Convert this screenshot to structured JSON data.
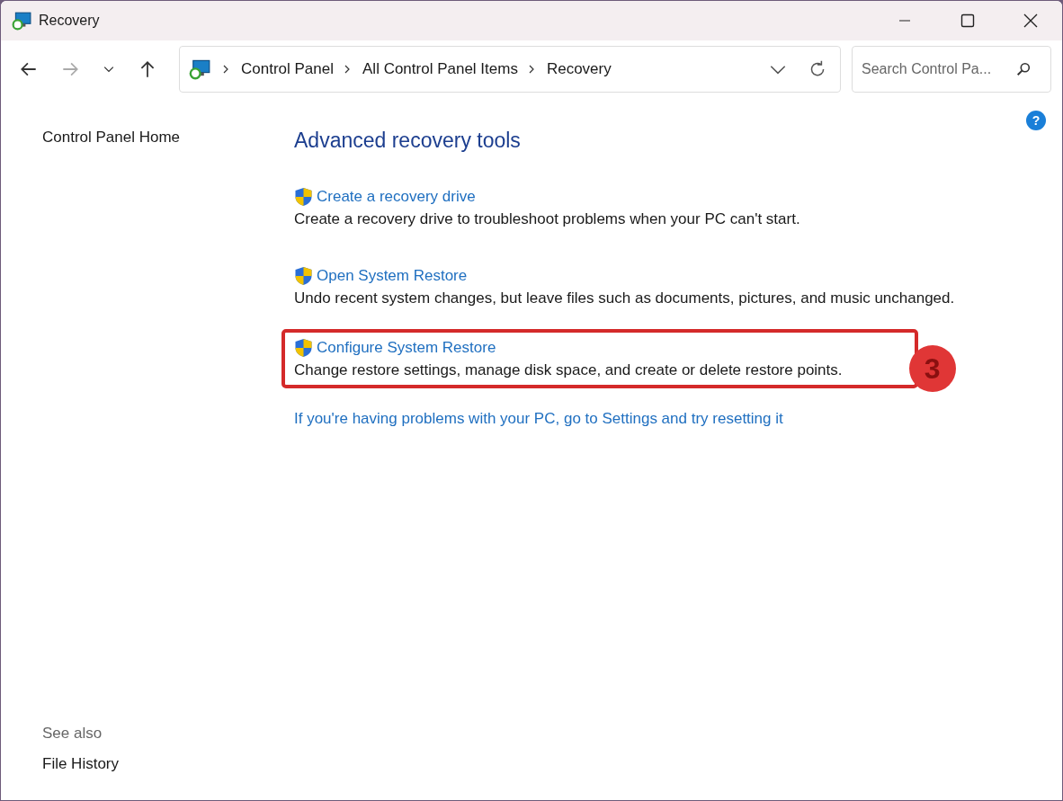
{
  "window": {
    "title": "Recovery"
  },
  "navigation": {
    "back_disabled": false,
    "forward_disabled": true,
    "breadcrumbs": [
      "Control Panel",
      "All Control Panel Items",
      "Recovery"
    ],
    "search": {
      "placeholder": "Search Control Pa..."
    }
  },
  "help_button": "?",
  "sidebar": {
    "home_link": "Control Panel Home",
    "see_also": {
      "heading": "See also",
      "links": [
        "File History"
      ]
    }
  },
  "main": {
    "heading": "Advanced recovery tools",
    "tasks": [
      {
        "link": "Create a recovery drive",
        "description": "Create a recovery drive to troubleshoot problems when your PC can't start.",
        "highlighted": false
      },
      {
        "link": "Open System Restore",
        "description": "Undo recent system changes, but leave files such as documents, pictures, and music unchanged.",
        "highlighted": false
      },
      {
        "link": "Configure System Restore",
        "description": "Change restore settings, manage disk space, and create or delete restore points.",
        "highlighted": true,
        "step_badge": "3"
      }
    ],
    "reset_link": "If you're having problems with your PC, go to Settings and try resetting it"
  }
}
